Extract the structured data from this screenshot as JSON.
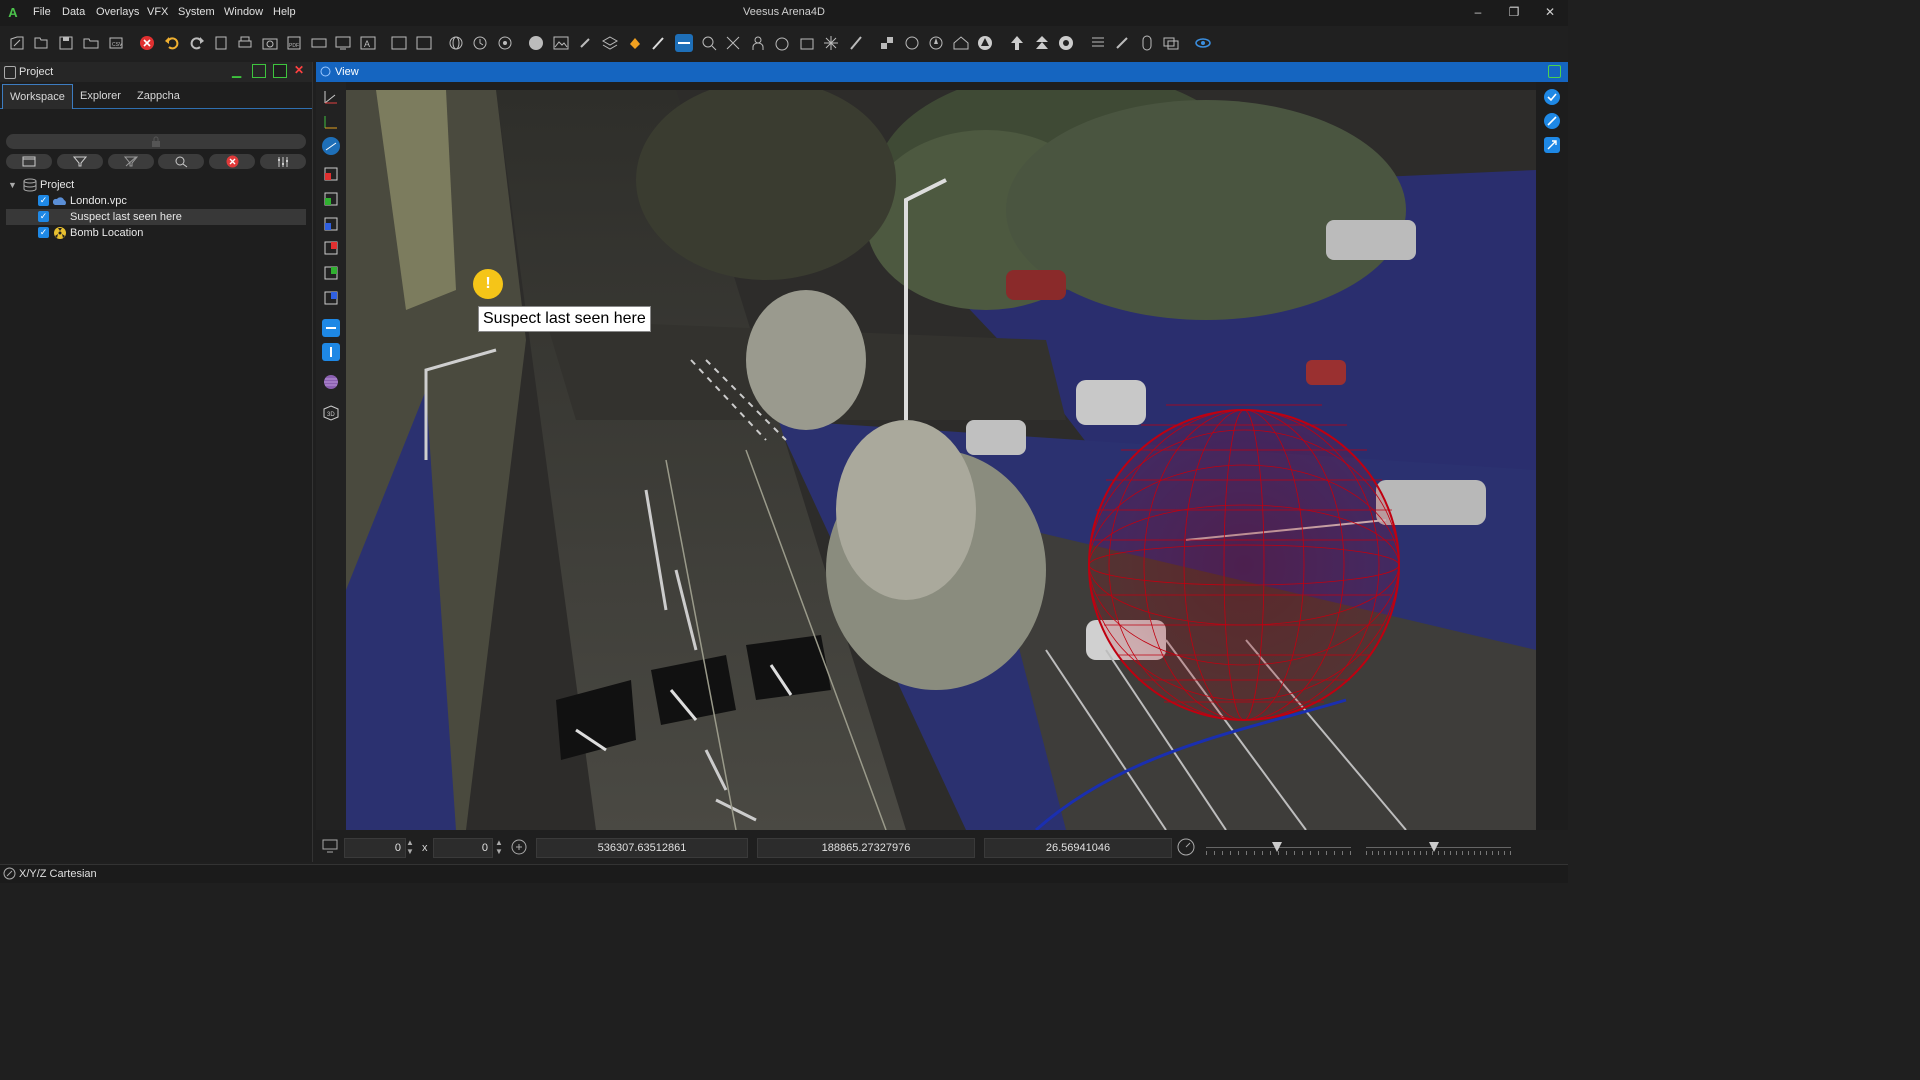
{
  "app": {
    "title": "Veesus Arena4D",
    "logo": "A"
  },
  "menu": [
    "File",
    "Data",
    "Overlays",
    "VFX",
    "System",
    "Window",
    "Help"
  ],
  "window_controls": {
    "minimize": "–",
    "restore": "❐",
    "close": "✕"
  },
  "panel": {
    "title": "Project",
    "tabs": [
      "Workspace",
      "Explorer",
      "Zappcha"
    ],
    "active_tab": "Workspace",
    "tree": {
      "root": "Project",
      "items": [
        {
          "label": "London.vpc",
          "checked": true
        },
        {
          "label": "Suspect last seen here",
          "checked": true
        },
        {
          "label": "Bomb Location",
          "checked": true
        }
      ]
    }
  },
  "view": {
    "title": "View",
    "annotation": "Suspect last seen here",
    "marker_icon": "!"
  },
  "status": {
    "width": "0",
    "separator": "x",
    "height": "0",
    "coord_x": "536307.63512861",
    "coord_y": "188865.27327976",
    "coord_z": "26.56941046"
  },
  "footer": {
    "coord_system": "X/Y/Z Cartesian"
  },
  "colors": {
    "accent": "#1565c0",
    "sphere": "#c00010",
    "marker": "#f5c518"
  }
}
